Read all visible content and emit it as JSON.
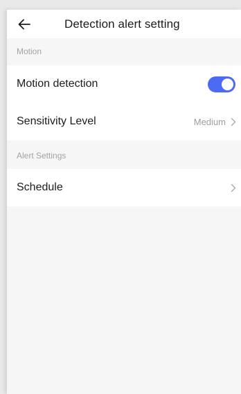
{
  "header": {
    "back_icon": "arrow-left-icon",
    "title": "Detection alert setting"
  },
  "sections": [
    {
      "label": "Motion",
      "rows": [
        {
          "label": "Motion detection",
          "control": "toggle",
          "enabled": true,
          "accent": "#4b6cf2"
        },
        {
          "label": "Sensitivity Level",
          "value": "Medium",
          "icon": "chevron-right-icon"
        }
      ]
    },
    {
      "label": "Alert Settings",
      "rows": [
        {
          "label": "Schedule",
          "icon": "chevron-right-icon"
        }
      ]
    }
  ]
}
